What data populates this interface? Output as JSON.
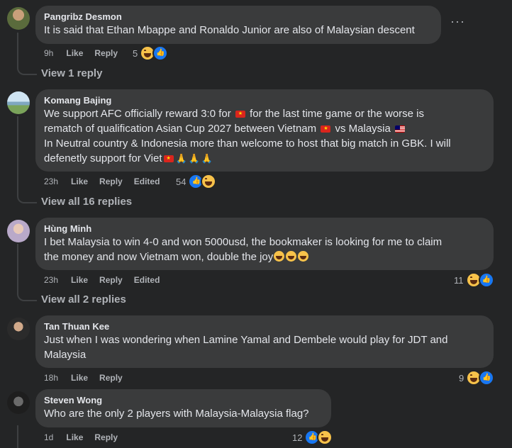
{
  "comments": [
    {
      "author": "Pangribz Desmon",
      "text": "It is said that Ethan Mbappe and Ronaldo Junior are also of Malaysian descent",
      "time": "9h",
      "like": "Like",
      "reply": "Reply",
      "reactions": "5",
      "view_replies": "View 1 reply"
    },
    {
      "author": "Komang Bajing",
      "line1a": "We support AFC officially reward 3:0 for",
      "line1b": "for the last time game or the worse is",
      "line2a": "rematch of qualification Asian Cup 2027 between Vietnam",
      "line2b": "vs Malaysia",
      "line3": "In Neutral country & Indonesia more than welcome to host that big match in GBK. I will",
      "line4": "defenetly support for Viet",
      "time": "23h",
      "like": "Like",
      "reply": "Reply",
      "edited": "Edited",
      "reactions": "54",
      "view_replies": "View all 16 replies"
    },
    {
      "author": "Hùng Minh",
      "line1": "I bet Malaysia to win 4-0 and won 5000usd, the bookmaker is looking for me to claim",
      "line2": "the money and now Vietnam won, double the joy",
      "time": "23h",
      "like": "Like",
      "reply": "Reply",
      "edited": "Edited",
      "reactions": "11",
      "view_replies": "View all 2 replies"
    },
    {
      "author": "Tan Thuan Kee",
      "line1": "Just when I was wondering when Lamine Yamal and Dembele would play for JDT and",
      "line2": "Malaysia",
      "time": "18h",
      "like": "Like",
      "reply": "Reply",
      "reactions": "9"
    },
    {
      "author": "Steven Wong",
      "text": "Who are the only 2 players with Malaysia-Malaysia flag?",
      "time": "1d",
      "like": "Like",
      "reply": "Reply",
      "reactions": "12"
    }
  ],
  "icons": {
    "more": "more-options-icon",
    "haha": "haha-reaction-icon",
    "like": "like-reaction-icon"
  }
}
